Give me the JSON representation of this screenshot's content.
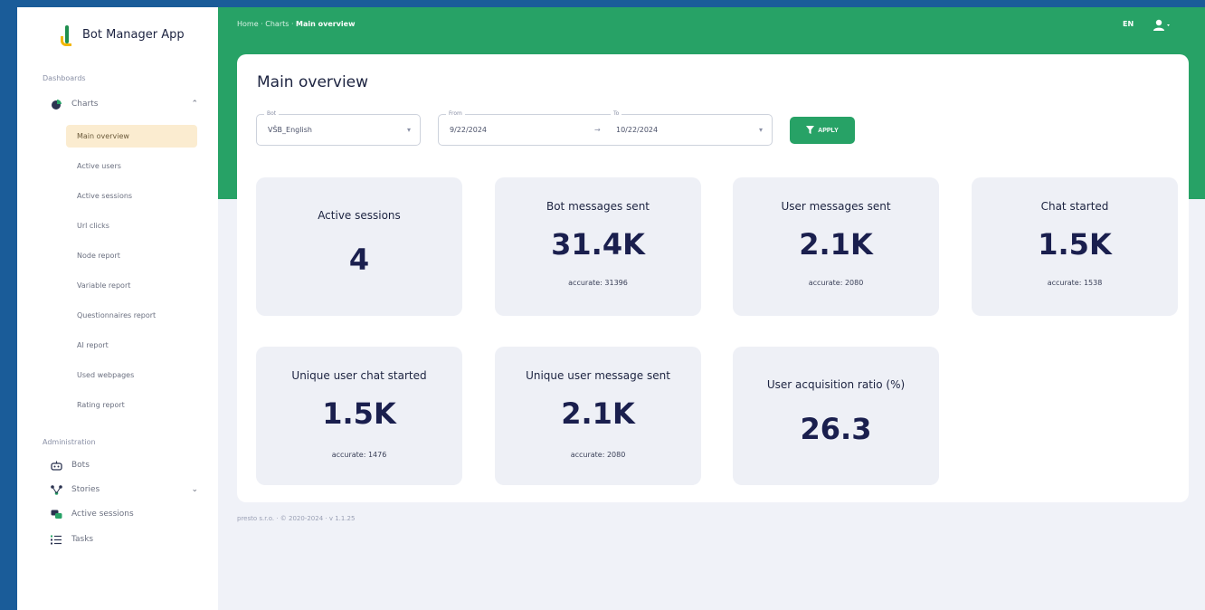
{
  "app": {
    "name": "Bot Manager App"
  },
  "sidebar": {
    "section_dashboards": "Dashboards",
    "charts_group": "Charts",
    "chart_items": [
      "Main overview",
      "Active users",
      "Active sessions",
      "Url clicks",
      "Node report",
      "Variable report",
      "Questionnaires report",
      "AI report",
      "Used webpages",
      "Rating report"
    ],
    "section_admin": "Administration",
    "admin_items": [
      "Bots",
      "Stories",
      "Active sessions",
      "Tasks"
    ]
  },
  "header": {
    "breadcrumb_prefix": "Home · Charts · ",
    "breadcrumb_current": "Main overview",
    "language": "EN"
  },
  "main": {
    "title": "Main overview",
    "filters": {
      "bot_label": "Bot",
      "bot_value": "VŠB_English",
      "from_label": "From",
      "from_value": "9/22/2024",
      "to_label": "To",
      "to_value": "10/22/2024",
      "range_arrow": "→",
      "apply_label": "APPLY"
    },
    "stats": [
      {
        "title": "Active sessions",
        "value": "4",
        "accurate": ""
      },
      {
        "title": "Bot messages sent",
        "value": "31.4K",
        "accurate": "accurate: 31396"
      },
      {
        "title": "User messages sent",
        "value": "2.1K",
        "accurate": "accurate: 2080"
      },
      {
        "title": "Chat started",
        "value": "1.5K",
        "accurate": "accurate: 1538"
      },
      {
        "title": "Unique user chat started",
        "value": "1.5K",
        "accurate": "accurate: 1476"
      },
      {
        "title": "Unique user message sent",
        "value": "2.1K",
        "accurate": "accurate: 2080"
      },
      {
        "title": "User acquisition ratio (%)",
        "value": "26.3",
        "accurate": ""
      }
    ]
  },
  "footer": {
    "text": "presto s.r.o. · © 2020-2024 · v 1.1.25"
  },
  "colors": {
    "accent_green": "#27a266",
    "active_item_bg": "#fbecd0",
    "card_bg": "#eef0f6"
  }
}
